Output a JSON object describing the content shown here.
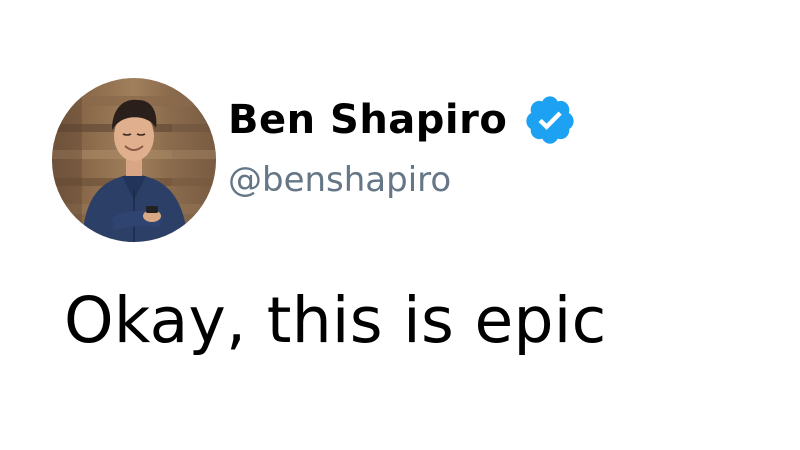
{
  "tweet": {
    "author": {
      "display_name": "Ben Shapiro",
      "handle": "@benshapiro",
      "verified": true,
      "verified_icon": "verified-badge-icon",
      "avatar_icon": "profile-photo"
    },
    "text": "Okay, this is epic"
  },
  "colors": {
    "background": "#ffffff",
    "text": "#000000",
    "handle": "#657786",
    "verified_blue": "#1da1f2"
  }
}
